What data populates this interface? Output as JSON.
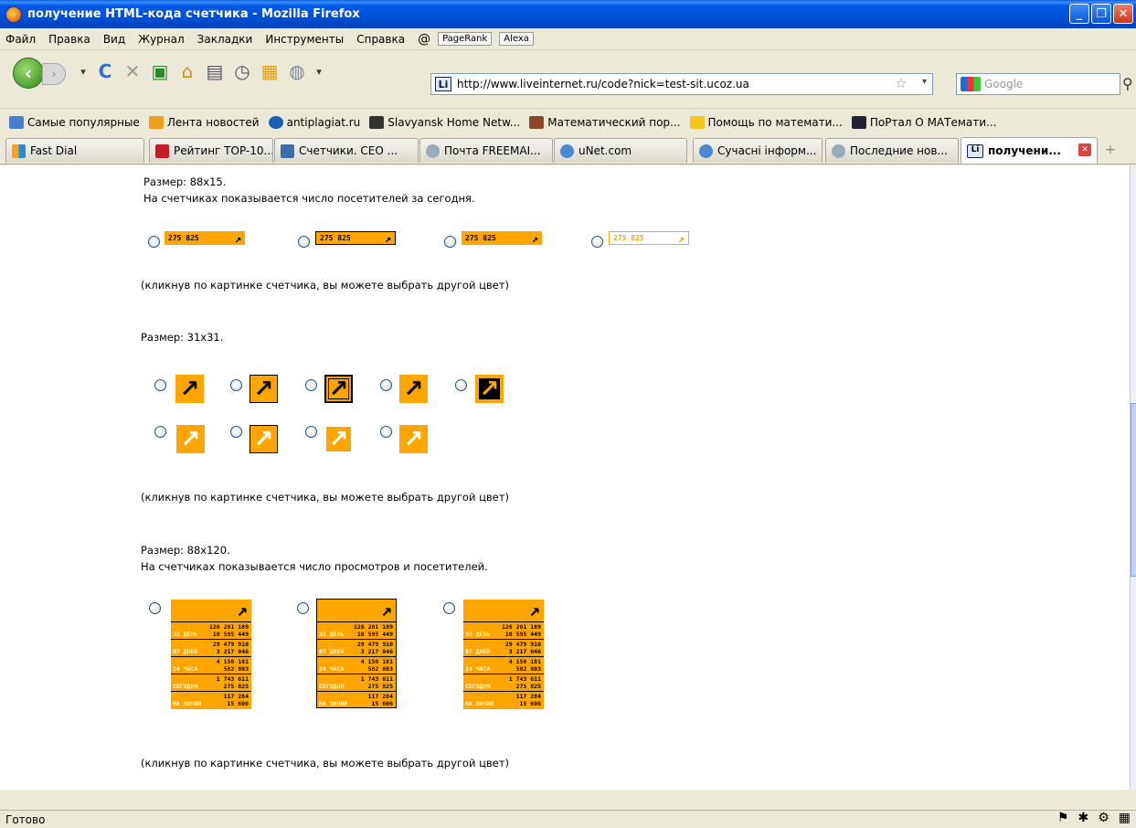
{
  "window": {
    "title": "получение HTML-кода счетчика - Mozilla Firefox"
  },
  "menu": [
    "Файл",
    "Правка",
    "Вид",
    "Журнал",
    "Закладки",
    "Инструменты",
    "Справка"
  ],
  "toolbar_widgets": {
    "pagerank": "PageRank",
    "alexa": "Alexa"
  },
  "address": {
    "url": "http://www.liveinternet.ru/code?nick=test-sit.ucoz.ua",
    "favicon": "Li"
  },
  "search": {
    "placeholder": "Google"
  },
  "bookmarks": [
    {
      "label": "Самые популярные"
    },
    {
      "label": "Лента новостей"
    },
    {
      "label": "antiplagiat.ru"
    },
    {
      "label": "Slavyansk Home Netw..."
    },
    {
      "label": "Математический пор..."
    },
    {
      "label": "Помощь по математи..."
    },
    {
      "label": "ПоРтал О МАТемати..."
    }
  ],
  "tabs": [
    {
      "label": "Fast Dial"
    },
    {
      "label": "Рейтинг ТОP-10..."
    },
    {
      "label": "Счетчики. CEO ..."
    },
    {
      "label": "Почта FREEMAI..."
    },
    {
      "label": "uNet.com"
    },
    {
      "label": "Сучасні інформ..."
    },
    {
      "label": "Последние нов..."
    },
    {
      "label": "получени...",
      "active": true
    }
  ],
  "page": {
    "size1": "Размер: 88x15.",
    "desc1": "На счетчиках показывается число посетителей за сегодня.",
    "hint": "(кликнув по картинке счетчика, вы можете выбрать другой цвет)",
    "size2": "Размер: 31x31.",
    "size3": "Размер: 88x120.",
    "desc3": "На счетчиках показывается число просмотров и посетителей.",
    "counter88_value": "275 825",
    "arrow": "↗",
    "c120": {
      "rows": [
        {
          "a": "126 201 189",
          "b": "10 595 449",
          "l": "31 ДЕНЬ"
        },
        {
          "a": "29 479 910",
          "b": "3 217 046",
          "l": "07 ДНЕЙ"
        },
        {
          "a": "4 150 181",
          "b": "582 803",
          "l": "24 ЧАСА"
        },
        {
          "a": "1 743 611",
          "b": "275 825",
          "l": "СЕГОДНЯ"
        },
        {
          "a": "117 284",
          "b": "15 606",
          "l": "НА ЛИНИИ"
        }
      ]
    }
  },
  "status": {
    "text": "Готово"
  },
  "colors": {
    "counter_orange": "#ffa500",
    "xp_blue": "#0050d8"
  }
}
